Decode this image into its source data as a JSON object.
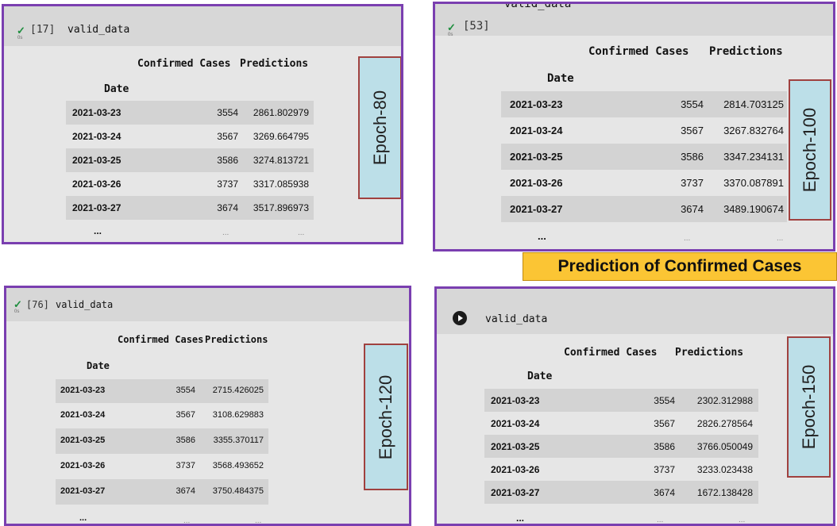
{
  "panels": [
    {
      "cell_number": "[17]",
      "code": "valid_data",
      "exec_time": "0s",
      "check": "✓",
      "columns": [
        "Confirmed Cases",
        "Predictions"
      ],
      "index_name": "Date",
      "rows": [
        {
          "date": "2021-03-23",
          "confirmed": "3554",
          "prediction": "2861.802979"
        },
        {
          "date": "2021-03-24",
          "confirmed": "3567",
          "prediction": "3269.664795"
        },
        {
          "date": "2021-03-25",
          "confirmed": "3586",
          "prediction": "3274.813721"
        },
        {
          "date": "2021-03-26",
          "confirmed": "3737",
          "prediction": "3317.085938"
        },
        {
          "date": "2021-03-27",
          "confirmed": "3674",
          "prediction": "3517.896973"
        }
      ],
      "ellipsis": "...",
      "ellipsis_small": "...",
      "epoch_label": "Epoch-80"
    },
    {
      "cell_number": "[53]",
      "code": "valid_data",
      "exec_time": "0s",
      "check": "✓",
      "columns": [
        "Confirmed Cases",
        "Predictions"
      ],
      "index_name": "Date",
      "rows": [
        {
          "date": "2021-03-23",
          "confirmed": "3554",
          "prediction": "2814.703125"
        },
        {
          "date": "2021-03-24",
          "confirmed": "3567",
          "prediction": "3267.832764"
        },
        {
          "date": "2021-03-25",
          "confirmed": "3586",
          "prediction": "3347.234131"
        },
        {
          "date": "2021-03-26",
          "confirmed": "3737",
          "prediction": "3370.087891"
        },
        {
          "date": "2021-03-27",
          "confirmed": "3674",
          "prediction": "3489.190674"
        }
      ],
      "ellipsis": "...",
      "ellipsis_small": "...",
      "epoch_label": "Epoch-100"
    },
    {
      "cell_number": "[76]",
      "code": "valid_data",
      "exec_time": "0s",
      "check": "✓",
      "columns": [
        "Confirmed Cases",
        "Predictions"
      ],
      "index_name": "Date",
      "rows": [
        {
          "date": "2021-03-23",
          "confirmed": "3554",
          "prediction": "2715.426025"
        },
        {
          "date": "2021-03-24",
          "confirmed": "3567",
          "prediction": "3108.629883"
        },
        {
          "date": "2021-03-25",
          "confirmed": "3586",
          "prediction": "3355.370117"
        },
        {
          "date": "2021-03-26",
          "confirmed": "3737",
          "prediction": "3568.493652"
        },
        {
          "date": "2021-03-27",
          "confirmed": "3674",
          "prediction": "3750.484375"
        }
      ],
      "ellipsis": "...",
      "ellipsis_small": "...",
      "epoch_label": "Epoch-120"
    },
    {
      "cell_number": "",
      "code": "valid_data",
      "exec_time": "",
      "check": "",
      "columns": [
        "Confirmed Cases",
        "Predictions"
      ],
      "index_name": "Date",
      "rows": [
        {
          "date": "2021-03-23",
          "confirmed": "3554",
          "prediction": "2302.312988"
        },
        {
          "date": "2021-03-24",
          "confirmed": "3567",
          "prediction": "2826.278564"
        },
        {
          "date": "2021-03-25",
          "confirmed": "3586",
          "prediction": "3766.050049"
        },
        {
          "date": "2021-03-26",
          "confirmed": "3737",
          "prediction": "3233.023438"
        },
        {
          "date": "2021-03-27",
          "confirmed": "3674",
          "prediction": "1672.138428"
        }
      ],
      "ellipsis": "...",
      "ellipsis_small": "...",
      "epoch_label": "Epoch-150"
    }
  ],
  "caption": "Prediction of Confirmed Cases",
  "colors": {
    "panel_border": "#7a3fb0",
    "epoch_fill": "#bcdfe8",
    "epoch_border": "#a0413f",
    "caption_fill": "#fbc534",
    "check_green": "#1e8e3e"
  },
  "icons": {
    "check": "check-icon",
    "run": "play-circle-icon"
  }
}
